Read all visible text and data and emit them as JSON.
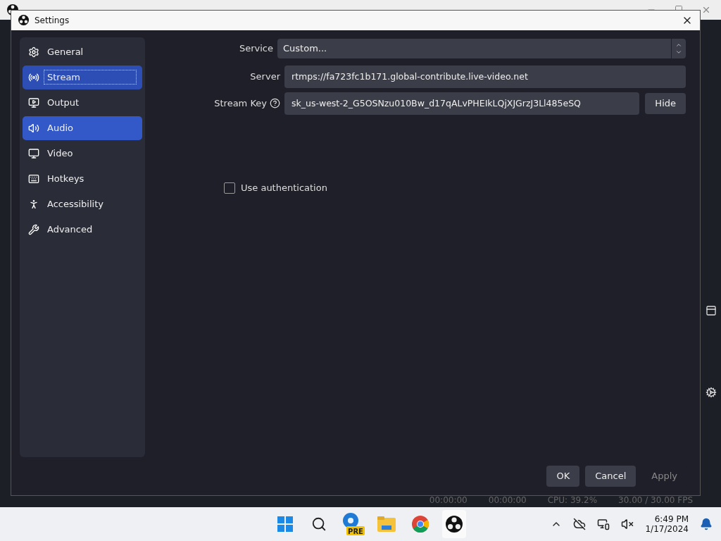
{
  "main_window": {
    "status_bar": [
      "00:00:00",
      "00:00:00",
      "CPU: 39.2%",
      "30.00 / 30.00 FPS"
    ]
  },
  "dialog": {
    "title": "Settings"
  },
  "sidebar": {
    "items": [
      {
        "kind": "gear",
        "label": "General",
        "selected": false,
        "hovered": false
      },
      {
        "kind": "antenna",
        "label": "Stream",
        "selected": true,
        "hovered": false
      },
      {
        "kind": "output",
        "label": "Output",
        "selected": false,
        "hovered": false
      },
      {
        "kind": "speaker",
        "label": "Audio",
        "selected": false,
        "hovered": true
      },
      {
        "kind": "monitor",
        "label": "Video",
        "selected": false,
        "hovered": false
      },
      {
        "kind": "keyboard",
        "label": "Hotkeys",
        "selected": false,
        "hovered": false
      },
      {
        "kind": "person",
        "label": "Accessibility",
        "selected": false,
        "hovered": false
      },
      {
        "kind": "tools",
        "label": "Advanced",
        "selected": false,
        "hovered": false
      }
    ]
  },
  "form": {
    "service": {
      "label": "Service",
      "value": "Custom..."
    },
    "server": {
      "label": "Server",
      "value": "rtmps://fa723fc1b171.global-contribute.live-video.net"
    },
    "stream_key": {
      "label": "Stream Key",
      "value": "sk_us-west-2_G5OSNzu010Bw_d17qALvPHEIkLQjXJGrzJ3Ll485eSQ",
      "button": "Hide"
    },
    "use_authentication": {
      "label": "Use authentication",
      "checked": false
    }
  },
  "buttons": [
    {
      "label": "OK",
      "disabled": false
    },
    {
      "label": "Cancel",
      "disabled": false
    },
    {
      "label": "Apply",
      "disabled": true
    }
  ],
  "taskbar": {
    "time": "6:49 PM",
    "date": "1/17/2024",
    "badge": "PRE"
  }
}
